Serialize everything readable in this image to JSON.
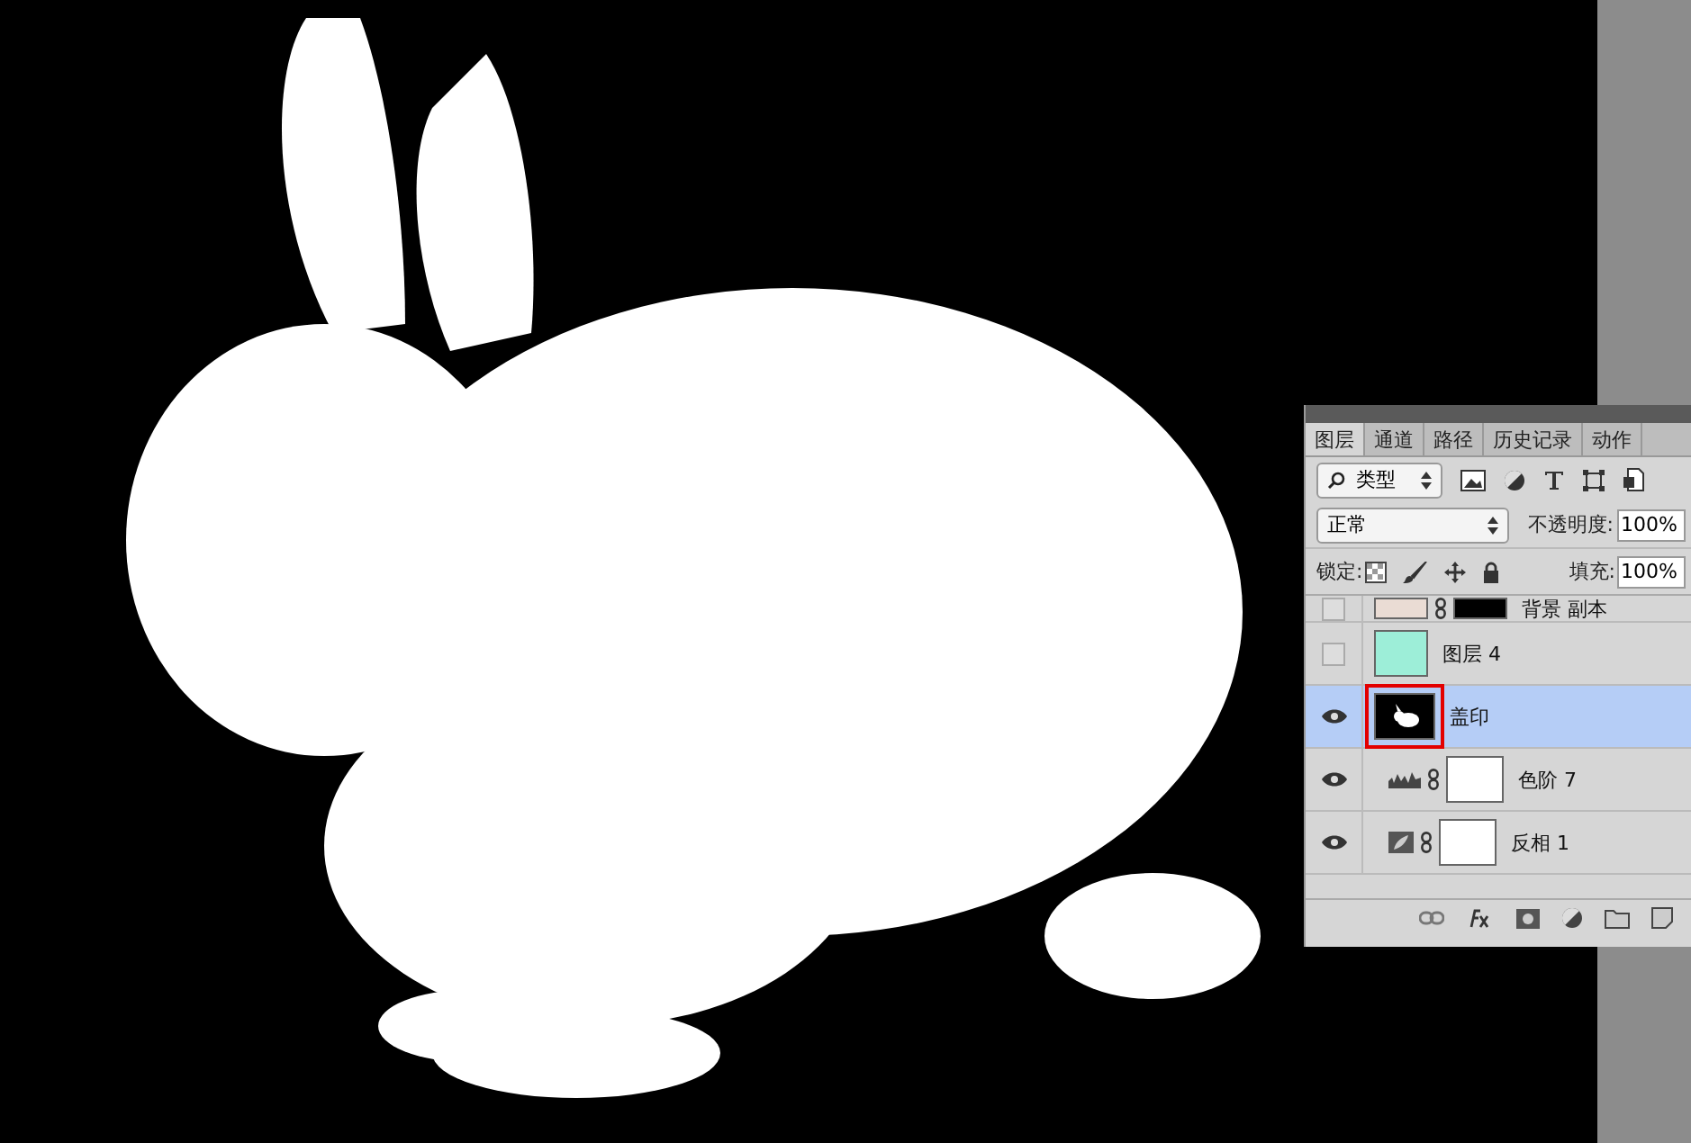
{
  "panel": {
    "tabs": [
      {
        "label": "图层",
        "selected": true
      },
      {
        "label": "通道",
        "selected": false
      },
      {
        "label": "路径",
        "selected": false
      },
      {
        "label": "历史记录",
        "selected": false
      },
      {
        "label": "动作",
        "selected": false
      }
    ],
    "filter": {
      "value": "类型"
    },
    "blend_mode": {
      "value": "正常"
    },
    "opacity": {
      "label": "不透明度:",
      "value": "100%"
    },
    "lock": {
      "label": "锁定:"
    },
    "fill": {
      "label": "填充:",
      "value": "100%"
    },
    "layers": [
      {
        "name": "背景 副本",
        "kind": "pixel-masked",
        "visible": false,
        "selected": false
      },
      {
        "name": "图层 4",
        "kind": "color",
        "color": "#9deed8",
        "visible": false,
        "selected": false
      },
      {
        "name": "盖印",
        "kind": "stamp",
        "visible": true,
        "selected": true
      },
      {
        "name": "色阶 7",
        "kind": "levels",
        "visible": true,
        "selected": false
      },
      {
        "name": "反相 1",
        "kind": "invert",
        "visible": true,
        "selected": false
      }
    ]
  }
}
